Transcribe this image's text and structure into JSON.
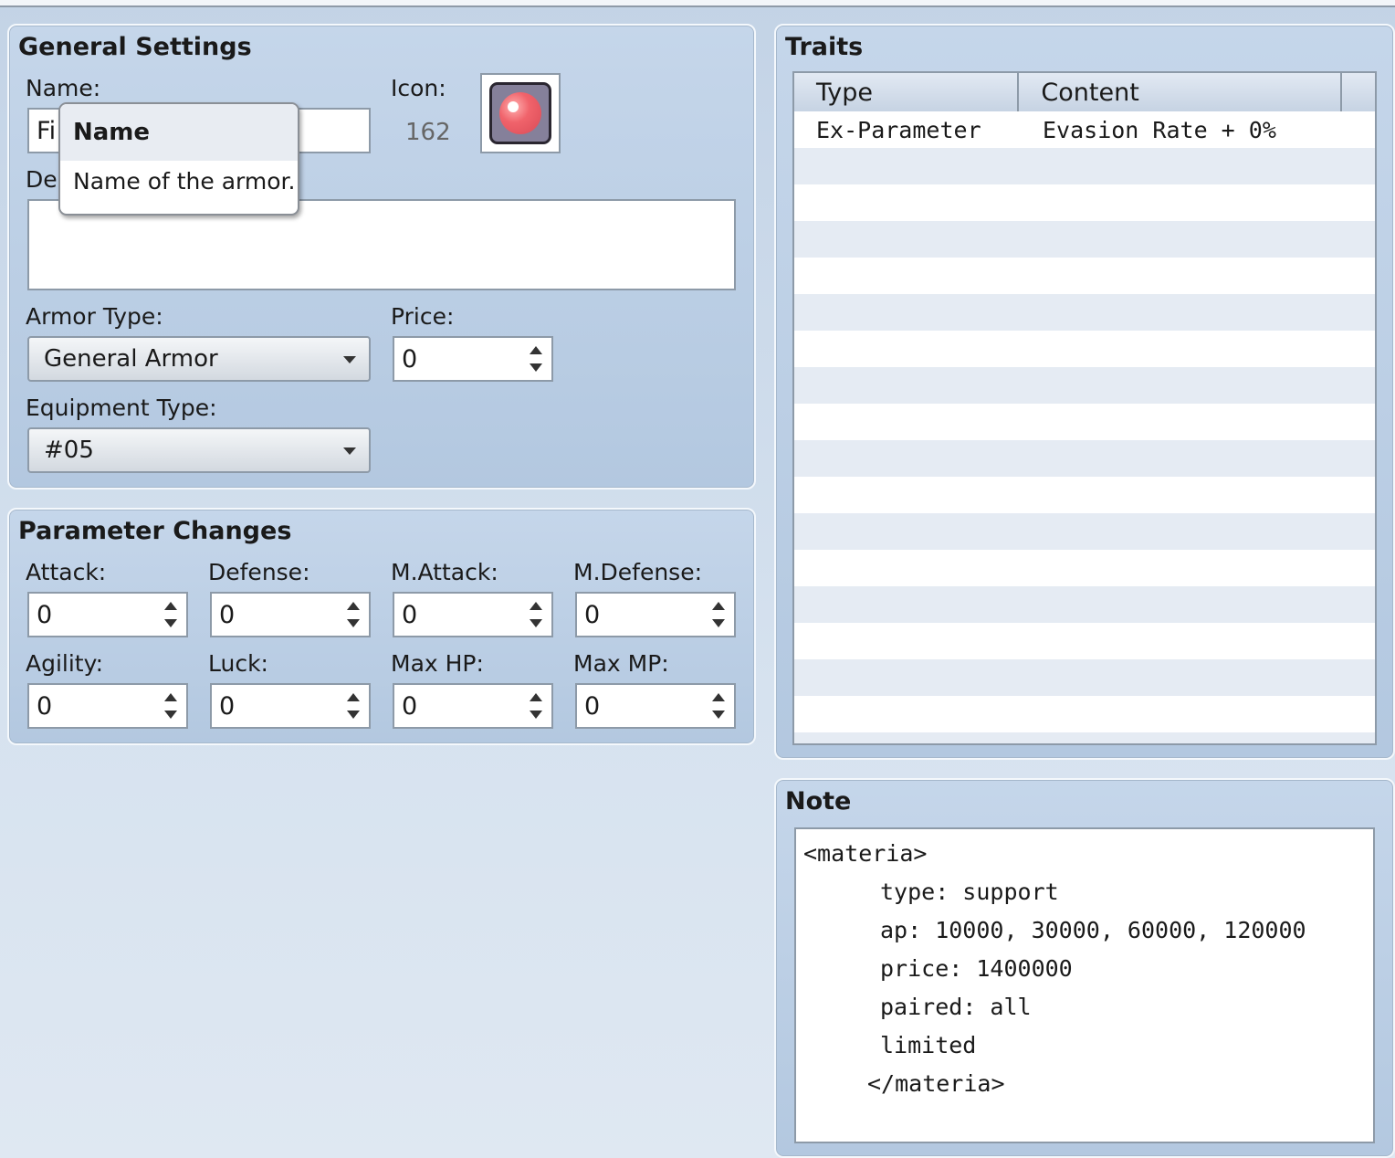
{
  "general": {
    "title": "General Settings",
    "name_label": "Name:",
    "name_value": "Fi",
    "icon_label": "Icon:",
    "icon_index": "162",
    "description_label": "De",
    "description_value": "",
    "armor_type_label": "Armor Type:",
    "armor_type_value": "General Armor",
    "price_label": "Price:",
    "price_value": "0",
    "equip_type_label": "Equipment Type:",
    "equip_type_value": "#05"
  },
  "tooltip": {
    "title": "Name",
    "text": "Name of the armor."
  },
  "params": {
    "title": "Parameter Changes",
    "fields": [
      {
        "label": "Attack:",
        "value": "0"
      },
      {
        "label": "Defense:",
        "value": "0"
      },
      {
        "label": "M.Attack:",
        "value": "0"
      },
      {
        "label": "M.Defense:",
        "value": "0"
      },
      {
        "label": "Agility:",
        "value": "0"
      },
      {
        "label": "Luck:",
        "value": "0"
      },
      {
        "label": "Max HP:",
        "value": "0"
      },
      {
        "label": "Max MP:",
        "value": "0"
      }
    ]
  },
  "traits": {
    "title": "Traits",
    "columns": [
      "Type",
      "Content"
    ],
    "rows": [
      {
        "type": "Ex-Parameter",
        "content": "Evasion Rate + 0%"
      }
    ]
  },
  "note": {
    "title": "Note",
    "lines": [
      "<materia>",
      "type: support",
      "ap: 10000, 30000, 60000, 120000",
      "price: 1400000",
      "paired: all",
      "limited",
      "</materia>"
    ]
  }
}
